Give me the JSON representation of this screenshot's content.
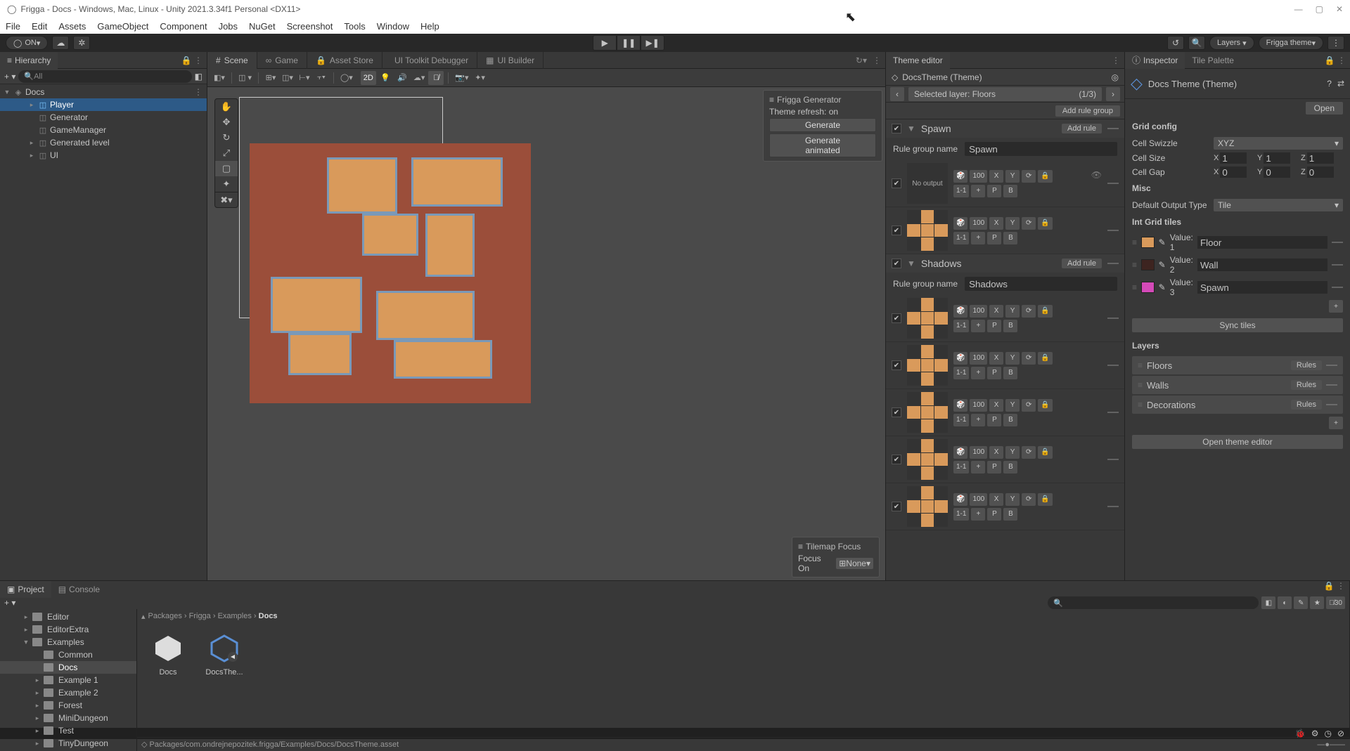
{
  "window": {
    "title": "Frigga - Docs - Windows, Mac, Linux - Unity 2021.3.34f1 Personal <DX11>"
  },
  "menu": [
    "File",
    "Edit",
    "Assets",
    "GameObject",
    "Component",
    "Jobs",
    "NuGet",
    "Screenshot",
    "Tools",
    "Window",
    "Help"
  ],
  "toolbar": {
    "on": "ON",
    "layers": "Layers",
    "layout": "Frigga theme"
  },
  "hierarchy": {
    "tab": "Hierarchy",
    "search": "All",
    "root": "Docs",
    "items": [
      {
        "name": "Player",
        "indent": 1,
        "sel": true,
        "arrow": true
      },
      {
        "name": "Generator",
        "indent": 1,
        "arrow": false
      },
      {
        "name": "GameManager",
        "indent": 1,
        "arrow": false
      },
      {
        "name": "Generated level",
        "indent": 1,
        "arrow": true
      },
      {
        "name": "UI",
        "indent": 1,
        "arrow": true
      }
    ]
  },
  "scene_tabs": [
    {
      "label": "Scene",
      "icon": "#"
    },
    {
      "label": "Game",
      "icon": "∞"
    },
    {
      "label": "Asset Store",
      "icon": "🔒"
    },
    {
      "label": "UI Toolkit Debugger",
      "icon": ""
    },
    {
      "label": "UI Builder",
      "icon": "▦"
    }
  ],
  "scene_toolbar": {
    "btn_2d": "2D"
  },
  "frigga_panel": {
    "title": "Frigga Generator",
    "refresh": "Theme refresh: on",
    "generate": "Generate",
    "generate_anim": "Generate animated"
  },
  "tilemap_panel": {
    "title": "Tilemap Focus",
    "focus_label": "Focus On",
    "focus_value": "None"
  },
  "theme_editor": {
    "tab": "Theme editor",
    "title": "DocsTheme (Theme)",
    "selected_layer": "Selected layer: Floors",
    "layer_count": "(1/3)",
    "add_group": "Add rule group",
    "groups": [
      {
        "name": "Spawn",
        "label": "Rule group name",
        "rules": [
          {
            "preview": "nooutput",
            "pct": "100",
            "range": "1-1"
          },
          {
            "preview": "center",
            "pct": "100",
            "range": "1-1"
          }
        ]
      },
      {
        "name": "Shadows",
        "label": "Rule group name",
        "rules": [
          {
            "preview": "s1",
            "pct": "100",
            "range": "1-1"
          },
          {
            "preview": "s2",
            "pct": "100",
            "range": "1-1"
          },
          {
            "preview": "s3",
            "pct": "100",
            "range": "1-1"
          },
          {
            "preview": "s4",
            "pct": "100",
            "range": "1-1"
          },
          {
            "preview": "s5",
            "pct": "100",
            "range": "1-1"
          }
        ]
      }
    ],
    "add_rule": "Add rule",
    "no_output": "No output"
  },
  "inspector": {
    "tab1": "Inspector",
    "tab2": "Tile Palette",
    "title": "Docs Theme (Theme)",
    "open": "Open",
    "grid_config": "Grid config",
    "swizzle": "Cell Swizzle",
    "swizzle_val": "XYZ",
    "size": "Cell Size",
    "gap": "Cell Gap",
    "size_x": "1",
    "size_y": "1",
    "size_z": "1",
    "gap_x": "0",
    "gap_y": "0",
    "gap_z": "0",
    "misc": "Misc",
    "output_type": "Default Output Type",
    "output_val": "Tile",
    "int_grid": "Int Grid tiles",
    "tiles": [
      {
        "val": "Value: 1",
        "name": "Floor",
        "color": "#d99a5b"
      },
      {
        "val": "Value: 2",
        "name": "Wall",
        "color": "#3d2420"
      },
      {
        "val": "Value: 3",
        "name": "Spawn",
        "color": "#d44ab8"
      }
    ],
    "sync": "Sync tiles",
    "layers_title": "Layers",
    "layers": [
      {
        "name": "Floors"
      },
      {
        "name": "Walls"
      },
      {
        "name": "Decorations"
      }
    ],
    "rules": "Rules",
    "open_editor": "Open theme editor"
  },
  "project": {
    "tab1": "Project",
    "tab2": "Console",
    "tree": [
      {
        "name": "Editor",
        "indent": 1,
        "folder": true,
        "arrow": true
      },
      {
        "name": "EditorExtra",
        "indent": 1,
        "folder": true,
        "arrow": true
      },
      {
        "name": "Examples",
        "indent": 1,
        "folder": true,
        "arrow": true,
        "open": true
      },
      {
        "name": "Common",
        "indent": 2,
        "folder": true
      },
      {
        "name": "Docs",
        "indent": 2,
        "folder": true,
        "sel": true
      },
      {
        "name": "Example 1",
        "indent": 2,
        "folder": true,
        "arrow": true
      },
      {
        "name": "Example 2",
        "indent": 2,
        "folder": true,
        "arrow": true
      },
      {
        "name": "Forest",
        "indent": 2,
        "folder": true,
        "arrow": true
      },
      {
        "name": "MiniDungeon",
        "indent": 2,
        "folder": true,
        "arrow": true
      },
      {
        "name": "Test",
        "indent": 2,
        "folder": true,
        "arrow": true
      },
      {
        "name": "TinyDungeon",
        "indent": 2,
        "folder": true,
        "arrow": true
      }
    ],
    "breadcrumb": [
      "Packages",
      "Frigga",
      "Examples",
      "Docs"
    ],
    "assets": [
      {
        "name": "Docs",
        "type": "unity"
      },
      {
        "name": "DocsThe...",
        "type": "theme"
      }
    ],
    "footer": "Packages/com.ondrejnepozitek.frigga/Examples/Docs/DocsTheme.asset",
    "count": "30"
  },
  "rule_btns": {
    "x": "X",
    "y": "Y",
    "p": "P",
    "b": "B",
    "plus": "+",
    "lock": "🔒",
    "reload": "⟳"
  }
}
